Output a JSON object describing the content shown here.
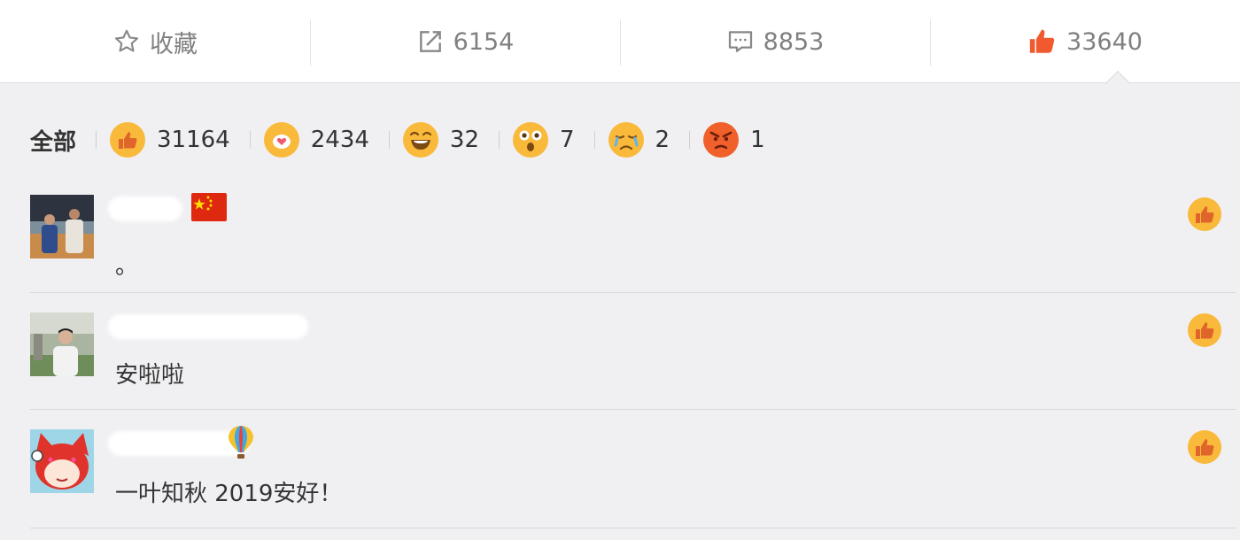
{
  "actions": {
    "favorite_label": "收藏",
    "repost_count": "6154",
    "comment_count": "8853",
    "like_count": "33640"
  },
  "reactions": {
    "all_label": "全部",
    "items": [
      {
        "icon": "like-emoji-icon",
        "count": "31164"
      },
      {
        "icon": "heart-emoji-icon",
        "count": "2434"
      },
      {
        "icon": "laugh-emoji-icon",
        "count": "32"
      },
      {
        "icon": "surprised-emoji-icon",
        "count": "7"
      },
      {
        "icon": "sad-emoji-icon",
        "count": "2"
      },
      {
        "icon": "angry-emoji-icon",
        "count": "1"
      }
    ]
  },
  "comments": [
    {
      "text": "。",
      "name_badge": "china-flag-icon"
    },
    {
      "text": "安啦啦"
    },
    {
      "text": "一叶知秋 2019安好！",
      "name_badge": "hot-air-balloon-icon"
    }
  ],
  "colors": {
    "accent_red": "#f15a2e",
    "emoji_yellow": "#f9b93a",
    "muted_text": "#808080"
  }
}
